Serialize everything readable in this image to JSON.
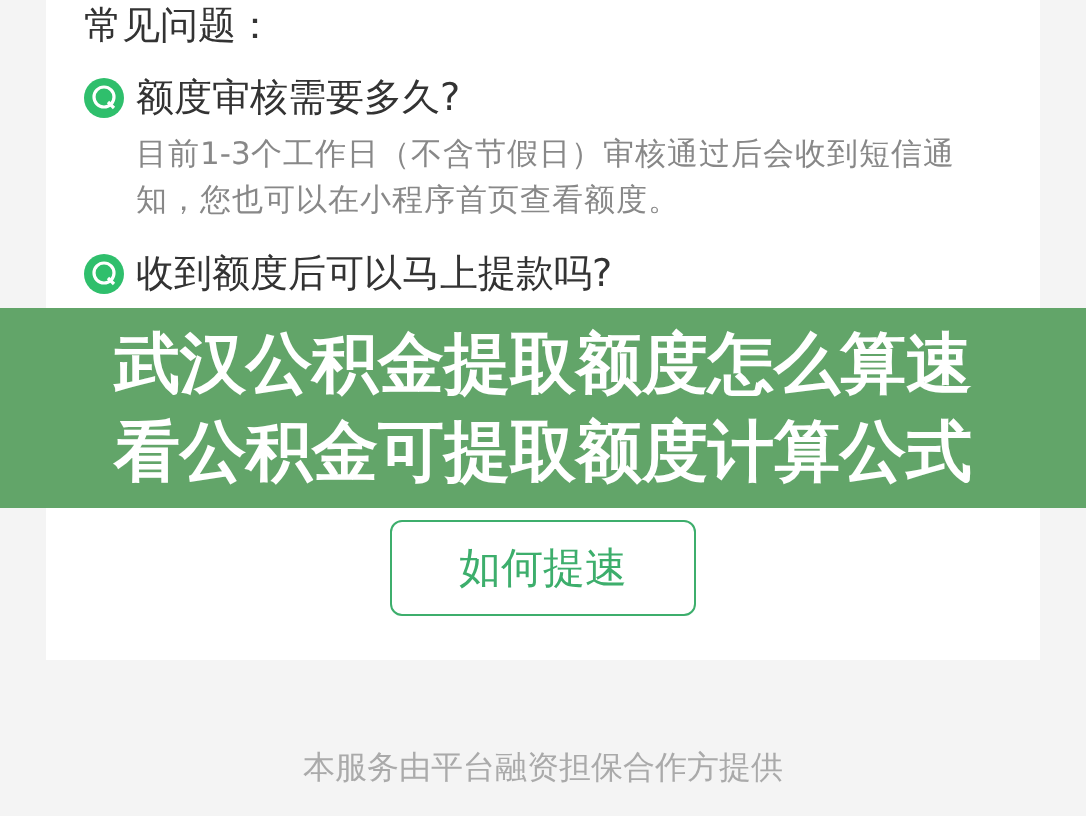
{
  "section_title": "常见问题：",
  "faq": [
    {
      "question": "额度审核需要多久?",
      "answer": "目前1-3个工作日（不含节假日）审核通过后会收到短信通知，您也可以在小程序首页查看额度。"
    },
    {
      "question": "收到额度后可以马上提款吗?"
    }
  ],
  "button": "如何提速",
  "footer": "本服务由平台融资担保合作方提供",
  "banner": {
    "lines": [
      "武汉公积金提取额度怎么算速",
      "看公积金可提取额度计算公式"
    ]
  }
}
